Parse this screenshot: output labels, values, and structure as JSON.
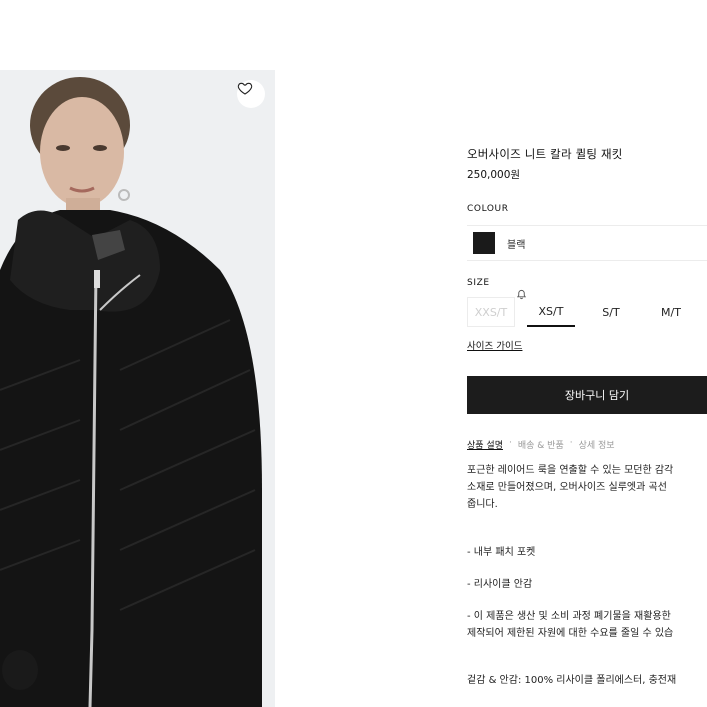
{
  "product": {
    "name": "오버사이즈 니트 칼라 퀼팅 재킷",
    "price": "250,000원"
  },
  "colour": {
    "label": "COLOUR",
    "selected": "블랙",
    "swatch_color": "#1a1a1a"
  },
  "size": {
    "label": "SIZE",
    "options": [
      {
        "label": "XXS/T",
        "state": "disabled"
      },
      {
        "label": "XS/T",
        "state": "selected"
      },
      {
        "label": "S/T",
        "state": "available"
      },
      {
        "label": "M/T",
        "state": "available"
      }
    ],
    "guide_label": "사이즈 가이드"
  },
  "cart": {
    "label": "장바구니 담기"
  },
  "tabs": [
    {
      "label": "상품 설명",
      "active": true
    },
    {
      "label": "배송 & 반품",
      "active": false
    },
    {
      "label": "상세 정보",
      "active": false
    }
  ],
  "tab_separator": "·",
  "description": {
    "lines": [
      "포근한 레이어드 룩을 연출할 수 있는 모던한 감각",
      "소재로 만들어졌으며, 오버사이즈 실루엣과 곡선",
      "줍니다."
    ],
    "bullets": [
      "- 내부 패치 포켓",
      "- 리사이클 안감",
      "- 이 제품은 생산 및 소비 과정 폐기물을 재활용한",
      "제작되어 제한된 자원에 대한 수요를 줄일 수 있습"
    ],
    "material": "겉감 & 안감: 100% 리사이클 폴리에스터, 충전재"
  },
  "icons": {
    "wishlist": "heart-icon",
    "notify": "bell-icon"
  }
}
